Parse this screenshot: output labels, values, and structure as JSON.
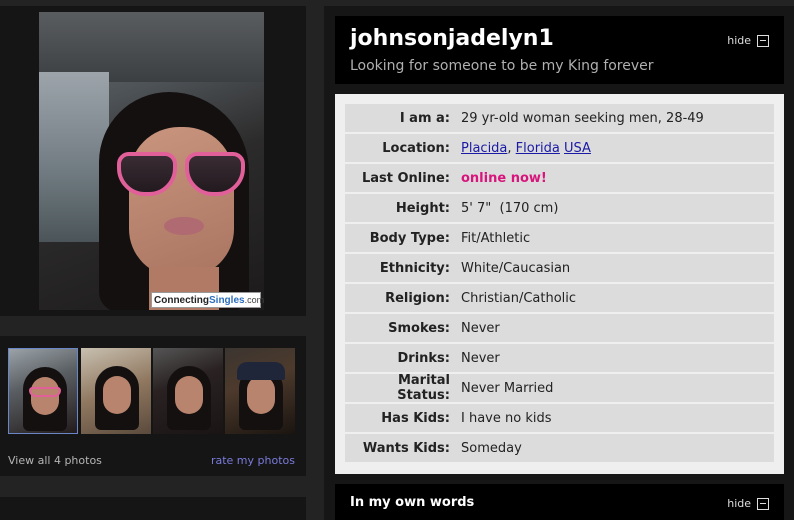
{
  "profile": {
    "username": "johnsonjadelyn1",
    "tagline": "Looking for someone to be my King forever",
    "hide_label": "hide"
  },
  "photo": {
    "watermark_a": "Connecting",
    "watermark_b": "Singles",
    "watermark_c": ".com"
  },
  "thumbs": {
    "view_all": "View all 4 photos",
    "rate": "rate my photos"
  },
  "details": [
    {
      "label": "I am a:",
      "value": "29 yr-old woman seeking men, 28-49"
    },
    {
      "label": "Location:",
      "city": "Placida",
      "sep": ", ",
      "state": "Florida",
      "country": "USA"
    },
    {
      "label": "Last Online:",
      "value": "online now!"
    },
    {
      "label": "Height:",
      "value": "5' 7\"  (170 cm)"
    },
    {
      "label": "Body Type:",
      "value": "Fit/Athletic"
    },
    {
      "label": "Ethnicity:",
      "value": "White/Caucasian"
    },
    {
      "label": "Religion:",
      "value": "Christian/Catholic"
    },
    {
      "label": "Smokes:",
      "value": "Never"
    },
    {
      "label": "Drinks:",
      "value": "Never"
    },
    {
      "label": "Marital Status:",
      "value": "Never Married"
    },
    {
      "label": "Has Kids:",
      "value": "I have no kids"
    },
    {
      "label": "Wants Kids:",
      "value": "Someday"
    }
  ],
  "own_words": {
    "title": "In my own words",
    "hide_label": "hide"
  },
  "colors": {
    "online": "#d8157c",
    "link": "#1a1aa6",
    "rate_link": "#7b7bdc"
  }
}
